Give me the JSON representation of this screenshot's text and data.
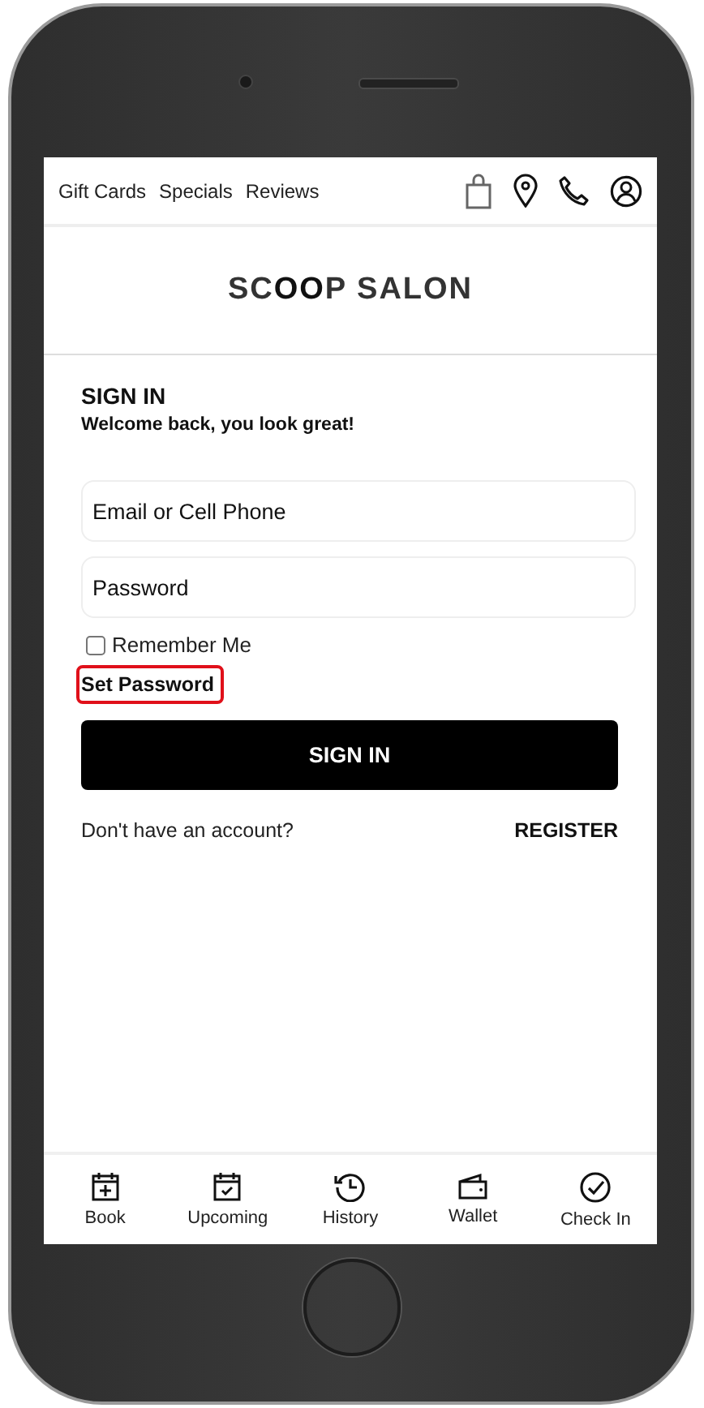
{
  "top_nav": {
    "links": [
      "Gift Cards",
      "Specials",
      "Reviews"
    ]
  },
  "logo": "SC**OO**P SALON",
  "sign_in": {
    "title": "SIGN IN",
    "subtitle": "Welcome back, you look great!",
    "fields": [
      {
        "placeholder": "Email or Cell Phone"
      },
      {
        "placeholder": "Password"
      }
    ],
    "remember_me": {
      "label": "Remember Me",
      "checked": false
    },
    "set_password": {
      "label": "Set Password",
      "highlighted": true
    },
    "button": "SIGN IN",
    "register_prompt": "Don't have an account?",
    "register": "REGISTER"
  },
  "tab_bar": [
    {
      "label": "Book"
    },
    {
      "label": "Upcoming"
    },
    {
      "label": "History"
    },
    {
      "label": "Wallet"
    },
    {
      "label": "Check In"
    }
  ]
}
